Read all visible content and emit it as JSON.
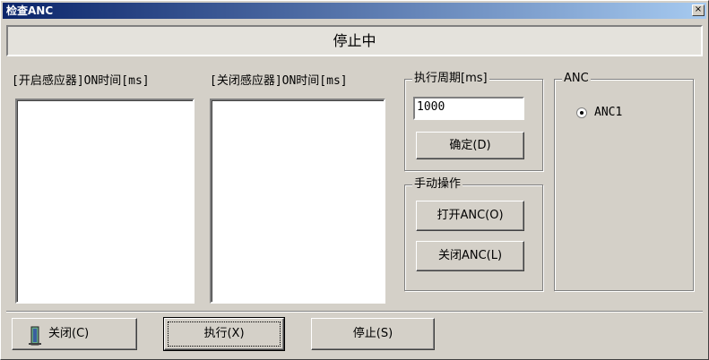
{
  "window": {
    "title": "检查ANC",
    "close_glyph": "×"
  },
  "status": {
    "text": "停止中"
  },
  "lists": {
    "on_label": "[开启感应器]ON时间[ms]",
    "off_label": "[关闭感应器]ON时间[ms]"
  },
  "period": {
    "group_title": "执行周期[ms]",
    "value": "1000",
    "confirm_label": "确定(D)"
  },
  "manual": {
    "group_title": "手动操作",
    "open_label": "打开ANC(O)",
    "close_label": "关闭ANC(L)"
  },
  "anc": {
    "group_title": "ANC",
    "option_label": "ANC1"
  },
  "footer": {
    "close_label": "关闭(C)",
    "execute_label": "执行(X)",
    "stop_label": "停止(S)"
  }
}
